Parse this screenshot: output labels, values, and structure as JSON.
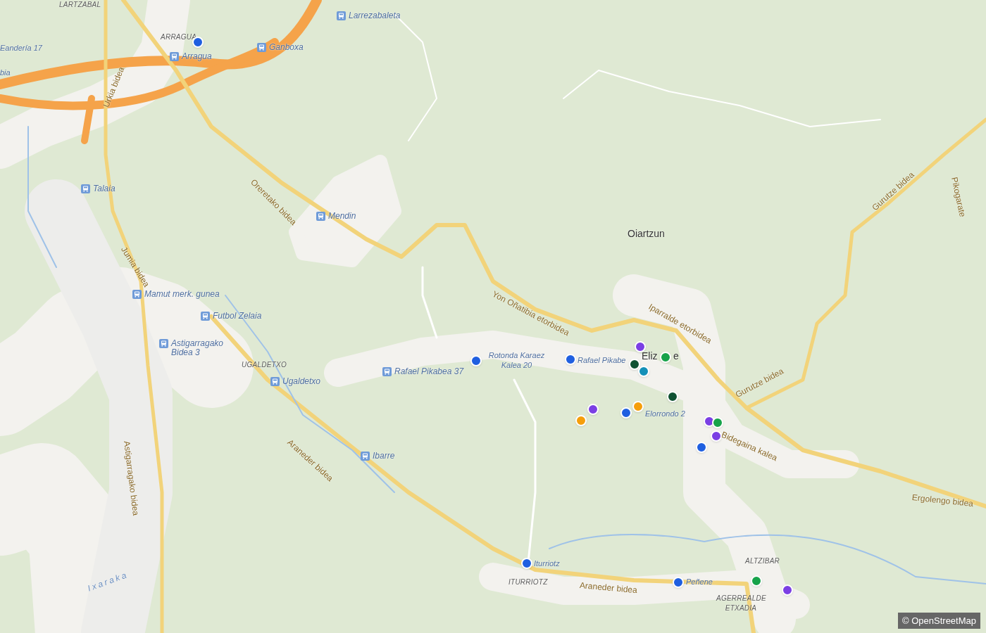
{
  "map": {
    "labels": [
      {
        "text": "LARTZABAL",
        "kind": "area"
      },
      {
        "text": "ARRAGUA",
        "kind": "area"
      },
      {
        "text": "Eandería 17",
        "kind": "stop"
      },
      {
        "text": "bia",
        "kind": "stop"
      },
      {
        "text": "Larrezabaleta",
        "kind": "bus"
      },
      {
        "text": "Ganboxa",
        "kind": "bus"
      },
      {
        "text": "Arragua",
        "kind": "bus"
      },
      {
        "text": "Urkia bidea",
        "kind": "road"
      },
      {
        "text": "Talaia",
        "kind": "bus"
      },
      {
        "text": "Oreretako bidea",
        "kind": "road"
      },
      {
        "text": "Mendin",
        "kind": "bus"
      },
      {
        "text": "Oiartzun",
        "kind": "town"
      },
      {
        "text": "Gurutze bidea",
        "kind": "road"
      },
      {
        "text": "Pikogarate",
        "kind": "road"
      },
      {
        "text": "Jumia bidea",
        "kind": "road"
      },
      {
        "text": "Mamut merk. gunea",
        "kind": "bus"
      },
      {
        "text": "Futbol Zelaia",
        "kind": "bus"
      },
      {
        "text": "Yon Oñatibia etorbidea",
        "kind": "road"
      },
      {
        "text": "Iparralde etorbidea",
        "kind": "road"
      },
      {
        "text": "Astigarragako Bidea 3",
        "kind": "bus"
      },
      {
        "text": "Rotonda Karaez Kalea 20",
        "kind": "stop"
      },
      {
        "text": "Rafael Pikabe",
        "kind": "stop"
      },
      {
        "text": "Eliz",
        "kind": "town"
      },
      {
        "text": "e",
        "kind": "town"
      },
      {
        "text": "UGALDETXO",
        "kind": "area"
      },
      {
        "text": "Rafael Pikabea 37",
        "kind": "bus"
      },
      {
        "text": "Ugaldetxo",
        "kind": "bus"
      },
      {
        "text": "Gurutze bidea",
        "kind": "road"
      },
      {
        "text": "Elorrondo 2",
        "kind": "stop"
      },
      {
        "text": "Bidegaina kalea",
        "kind": "road"
      },
      {
        "text": "Araneder bidea",
        "kind": "road"
      },
      {
        "text": "Astigarragako bidea",
        "kind": "road"
      },
      {
        "text": "Ibarre",
        "kind": "bus"
      },
      {
        "text": "Ergolengo bidea",
        "kind": "road"
      },
      {
        "text": "Iturriotz",
        "kind": "stop"
      },
      {
        "text": "ITURRIOTZ",
        "kind": "area"
      },
      {
        "text": "Araneder bidea",
        "kind": "road"
      },
      {
        "text": "Peñene",
        "kind": "stop"
      },
      {
        "text": "ALTZIBAR",
        "kind": "area"
      },
      {
        "text": "AGERREALDE ETXADIA",
        "kind": "area"
      },
      {
        "text": "Ixaraka",
        "kind": "water"
      }
    ],
    "markers": [
      {
        "color": "#1f5fe0"
      },
      {
        "color": "#1f5fe0"
      },
      {
        "color": "#1f5fe0"
      },
      {
        "color": "#7b3fe4"
      },
      {
        "color": "#17a34a"
      },
      {
        "color": "#0f5132"
      },
      {
        "color": "#1390b8"
      },
      {
        "color": "#0f5132"
      },
      {
        "color": "#7b3fe4"
      },
      {
        "color": "#f59e0b"
      },
      {
        "color": "#f59e0b"
      },
      {
        "color": "#1f5fe0"
      },
      {
        "color": "#7b3fe4"
      },
      {
        "color": "#17a34a"
      },
      {
        "color": "#7b3fe4"
      },
      {
        "color": "#1f5fe0"
      },
      {
        "color": "#1f5fe0"
      },
      {
        "color": "#1f5fe0"
      },
      {
        "color": "#17a34a"
      },
      {
        "color": "#7b3fe4"
      }
    ],
    "attribution": "© OpenStreetMap"
  }
}
